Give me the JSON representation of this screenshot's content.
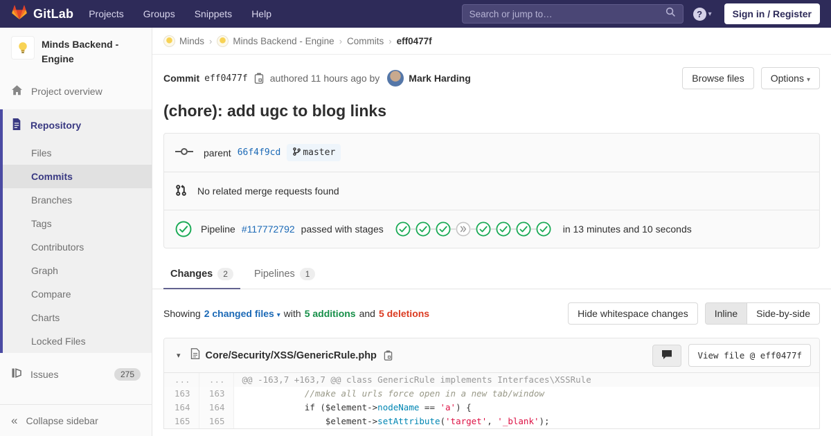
{
  "icons": {
    "caret_down": "▾",
    "chevron_right": "›",
    "collapse": "«",
    "help": "?"
  },
  "navbar": {
    "brand": "GitLab",
    "menu": [
      "Projects",
      "Groups",
      "Snippets",
      "Help"
    ],
    "search_placeholder": "Search or jump to…",
    "signin_label": "Sign in / Register"
  },
  "sidebar": {
    "project_title": "Minds Backend - Engine",
    "overview_label": "Project overview",
    "repository_label": "Repository",
    "repo_items": [
      "Files",
      "Commits",
      "Branches",
      "Tags",
      "Contributors",
      "Graph",
      "Compare",
      "Charts",
      "Locked Files"
    ],
    "active_repo_item": "Commits",
    "issues_label": "Issues",
    "issues_count": "275",
    "collapse_label": "Collapse sidebar"
  },
  "breadcrumb": {
    "items": [
      {
        "label": "Minds",
        "avatar": true,
        "current": false
      },
      {
        "label": "Minds Backend - Engine",
        "avatar": true,
        "current": false
      },
      {
        "label": "Commits",
        "avatar": false,
        "current": false
      },
      {
        "label": "eff0477f",
        "avatar": false,
        "current": true
      }
    ]
  },
  "commit": {
    "label": "Commit",
    "sha": "eff0477f",
    "authored": "authored 11 hours ago by",
    "author": "Mark Harding",
    "browse_files_label": "Browse files",
    "options_label": "Options",
    "title": "(chore): add ugc to blog links",
    "parent_label": "parent",
    "parent_sha": "66f4f9cd",
    "branch": "master",
    "no_merge_requests": "No related merge requests found",
    "pipeline_label": "Pipeline",
    "pipeline_id": "#117772792",
    "pipeline_status": "passed with stages",
    "stages": [
      "passed",
      "passed",
      "passed",
      "skipped",
      "passed",
      "passed",
      "passed",
      "passed"
    ],
    "pipeline_duration": "in 13 minutes and 10 seconds"
  },
  "tabs": [
    {
      "label": "Changes",
      "count": "2",
      "active": true
    },
    {
      "label": "Pipelines",
      "count": "1",
      "active": false
    }
  ],
  "diff_toolbar": {
    "showing": "Showing",
    "changed_files": "2 changed files",
    "with": "with",
    "additions": "5 additions",
    "and": "and",
    "deletions": "5 deletions",
    "hide_whitespace_label": "Hide whitespace changes",
    "inline_label": "Inline",
    "side_by_side_label": "Side-by-side"
  },
  "file": {
    "path": "Core/Security/XSS/GenericRule.php",
    "view_file_label": "View file @ eff0477f",
    "diff": [
      {
        "old": "...",
        "new": "...",
        "type": "hunk",
        "code": [
          {
            "t": "@@ -163,7 +163,7 @@ class GenericRule implements Interfaces\\XSSRule",
            "c": ""
          }
        ]
      },
      {
        "old": "163",
        "new": "163",
        "type": "",
        "code": [
          {
            "t": "            ",
            "c": ""
          },
          {
            "t": "//make all urls force open in a new tab/window",
            "c": "cm"
          }
        ]
      },
      {
        "old": "164",
        "new": "164",
        "type": "",
        "code": [
          {
            "t": "            if ($element->",
            "c": ""
          },
          {
            "t": "nodeName",
            "c": "fn"
          },
          {
            "t": " == ",
            "c": ""
          },
          {
            "t": "'a'",
            "c": "st"
          },
          {
            "t": ") {",
            "c": ""
          }
        ]
      },
      {
        "old": "165",
        "new": "165",
        "type": "",
        "code": [
          {
            "t": "                $element->",
            "c": ""
          },
          {
            "t": "setAttribute",
            "c": "fn"
          },
          {
            "t": "(",
            "c": ""
          },
          {
            "t": "'target'",
            "c": "st"
          },
          {
            "t": ", ",
            "c": ""
          },
          {
            "t": "'_blank'",
            "c": "st"
          },
          {
            "t": ");",
            "c": ""
          }
        ]
      }
    ]
  }
}
